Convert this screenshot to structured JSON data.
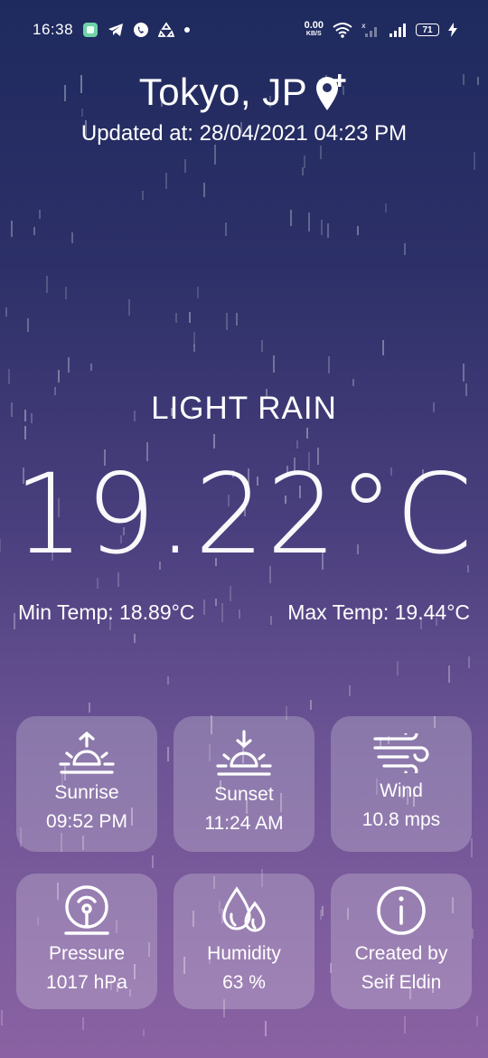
{
  "status_bar": {
    "time": "16:38",
    "net_speed_value": "0.00",
    "net_speed_unit": "KB/S",
    "battery": "71"
  },
  "header": {
    "city": "Tokyo, JP",
    "updated": "Updated at: 28/04/2021 04:23 PM"
  },
  "weather": {
    "condition": "LIGHT RAIN",
    "temperature": "19.22°C",
    "min_temp": "Min Temp: 18.89°C",
    "max_temp": "Max Temp: 19.44°C"
  },
  "cards": {
    "sunrise": {
      "label": "Sunrise",
      "value": "09:52 PM",
      "icon": "sunrise-icon"
    },
    "sunset": {
      "label": "Sunset",
      "value": "11:24 AM",
      "icon": "sunset-icon"
    },
    "wind": {
      "label": "Wind",
      "value": "10.8 mps",
      "icon": "wind-icon"
    },
    "pressure": {
      "label": "Pressure",
      "value": "1017 hPa",
      "icon": "pressure-gauge-icon"
    },
    "humidity": {
      "label": "Humidity",
      "value": "63 %",
      "icon": "droplets-icon"
    },
    "credits": {
      "label": "Created by",
      "value": "Seif Eldin",
      "icon": "info-icon"
    }
  },
  "colors": {
    "background_top": "#1e2a5e",
    "background_bottom": "#8a62a3",
    "card": "rgba(255,255,255,0.22)"
  }
}
